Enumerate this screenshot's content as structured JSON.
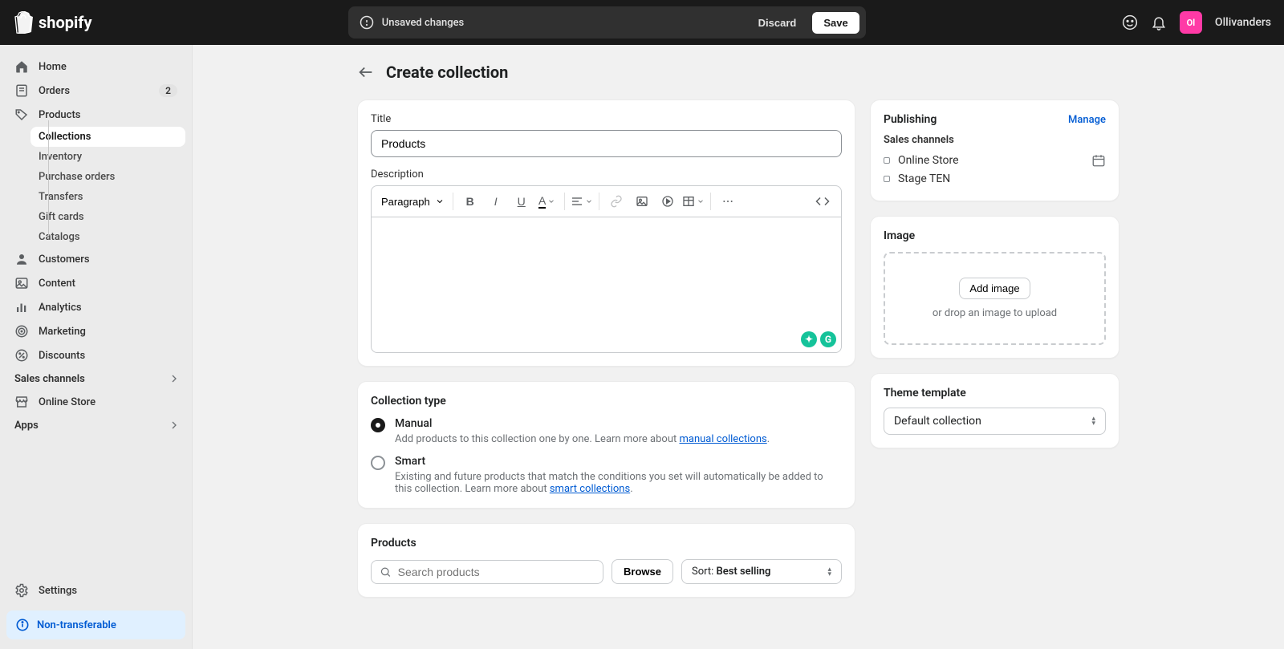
{
  "topbar": {
    "brand": "shopify",
    "unsaved": "Unsaved changes",
    "discard": "Discard",
    "save": "Save",
    "avatar_initials": "Ol",
    "username": "Ollivanders"
  },
  "sidebar": {
    "home": "Home",
    "orders": "Orders",
    "orders_badge": "2",
    "products": "Products",
    "products_sub": {
      "collections": "Collections",
      "inventory": "Inventory",
      "purchase_orders": "Purchase orders",
      "transfers": "Transfers",
      "gift_cards": "Gift cards",
      "catalogs": "Catalogs"
    },
    "customers": "Customers",
    "content": "Content",
    "analytics": "Analytics",
    "marketing": "Marketing",
    "discounts": "Discounts",
    "sales_channels": "Sales channels",
    "online_store": "Online Store",
    "apps": "Apps",
    "settings": "Settings",
    "nontransferable": "Non-transferable"
  },
  "page": {
    "title": "Create collection",
    "title_label": "Title",
    "title_value": "Products",
    "description_label": "Description",
    "rte_style": "Paragraph",
    "collection_type": {
      "heading": "Collection type",
      "manual_label": "Manual",
      "manual_help_prefix": "Add products to this collection one by one. Learn more about ",
      "manual_link": "manual collections",
      "smart_label": "Smart",
      "smart_help_prefix": "Existing and future products that match the conditions you set will automatically be added to this collection. Learn more about ",
      "smart_link": "smart collections"
    },
    "products": {
      "heading": "Products",
      "search_placeholder": "Search products",
      "browse": "Browse",
      "sort_prefix": "Sort: ",
      "sort_value": "Best selling"
    }
  },
  "side": {
    "publishing": {
      "title": "Publishing",
      "manage": "Manage",
      "sales_channels": "Sales channels",
      "channels": [
        "Online Store",
        "Stage TEN"
      ]
    },
    "image": {
      "title": "Image",
      "add_image": "Add image",
      "hint": "or drop an image to upload"
    },
    "theme": {
      "title": "Theme template",
      "value": "Default collection"
    }
  }
}
